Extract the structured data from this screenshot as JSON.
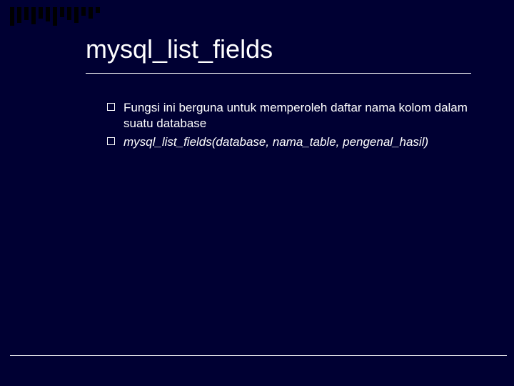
{
  "title": "mysql_list_fields",
  "bullets": [
    {
      "text": "Fungsi ini berguna untuk memperoleh daftar nama kolom dalam suatu database",
      "italic": false
    },
    {
      "text": "mysql_list_fields(database, nama_table, pengenal_hasil)",
      "italic": true
    }
  ]
}
